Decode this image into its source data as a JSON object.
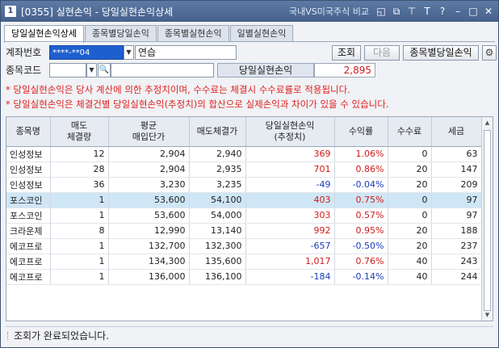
{
  "window": {
    "number": "1",
    "title": "[0355] 실현손익 - 당일실현손익상세",
    "compare_link": "국내VS미국주식 비교",
    "controls": [
      "◱",
      "⧉",
      "⊤",
      "T",
      "?",
      "–",
      "□",
      "✕"
    ]
  },
  "tabs": [
    {
      "label": "당일실현손익상세",
      "active": true
    },
    {
      "label": "종목별당일손익",
      "active": false
    },
    {
      "label": "종목별실현손익",
      "active": false
    },
    {
      "label": "일별실현손익",
      "active": false
    }
  ],
  "form": {
    "account_label": "계좌번호",
    "account_value": "****-**04",
    "account_name": "연습",
    "stock_code_label": "종목코드",
    "stock_code_value": "",
    "stock_name_value": "",
    "total_label": "당일실현손익",
    "total_value": "2,895"
  },
  "buttons": {
    "query": "조회",
    "next": "다음",
    "stock_daily": "종목별당일손익"
  },
  "notes": [
    "* 당일실현손익은 당사 계산에 의한 추정치이며, 수수료는 체결시 수수료률로 적용됩니다.",
    "* 당일실현손익은 체결건별 당일실현손익(추정치)의 합산으로 실제손익과 차이가 있을 수 있습니다."
  ],
  "table": {
    "headers": [
      "종목명",
      "매도\n체결량",
      "평균\n매입단가",
      "매도체결가",
      "당일실현손익\n(추정치)",
      "수익률",
      "수수료",
      "세금"
    ],
    "rows": [
      {
        "name": "인성정보",
        "qty": "12",
        "avg": "2,904",
        "sell": "2,940",
        "pnl": "369",
        "rate": "1.06%",
        "fee": "0",
        "tax": "63",
        "sign": "pos",
        "selected": false
      },
      {
        "name": "인성정보",
        "qty": "28",
        "avg": "2,904",
        "sell": "2,935",
        "pnl": "701",
        "rate": "0.86%",
        "fee": "20",
        "tax": "147",
        "sign": "pos",
        "selected": false
      },
      {
        "name": "인성정보",
        "qty": "36",
        "avg": "3,230",
        "sell": "3,235",
        "pnl": "-49",
        "rate": "-0.04%",
        "fee": "20",
        "tax": "209",
        "sign": "neg",
        "selected": false
      },
      {
        "name": "포스코인",
        "qty": "1",
        "avg": "53,600",
        "sell": "54,100",
        "pnl": "403",
        "rate": "0.75%",
        "fee": "0",
        "tax": "97",
        "sign": "pos",
        "selected": true
      },
      {
        "name": "포스코인",
        "qty": "1",
        "avg": "53,600",
        "sell": "54,000",
        "pnl": "303",
        "rate": "0.57%",
        "fee": "0",
        "tax": "97",
        "sign": "pos",
        "selected": false
      },
      {
        "name": "크라운제",
        "qty": "8",
        "avg": "12,990",
        "sell": "13,140",
        "pnl": "992",
        "rate": "0.95%",
        "fee": "20",
        "tax": "188",
        "sign": "pos",
        "selected": false
      },
      {
        "name": "에코프로",
        "qty": "1",
        "avg": "132,700",
        "sell": "132,300",
        "pnl": "-657",
        "rate": "-0.50%",
        "fee": "20",
        "tax": "237",
        "sign": "neg",
        "selected": false
      },
      {
        "name": "에코프로",
        "qty": "1",
        "avg": "134,300",
        "sell": "135,600",
        "pnl": "1,017",
        "rate": "0.76%",
        "fee": "40",
        "tax": "243",
        "sign": "pos",
        "selected": false
      },
      {
        "name": "에코프로",
        "qty": "1",
        "avg": "136,000",
        "sell": "136,100",
        "pnl": "-184",
        "rate": "-0.14%",
        "fee": "40",
        "tax": "244",
        "sign": "neg",
        "selected": false
      }
    ]
  },
  "status": "조회가 완료되었습니다.",
  "colors": {
    "positive": "#d11a1a",
    "negative": "#1a3cb8",
    "selected_row": "#cfe6f7",
    "account_bg": "#1e5fd0"
  }
}
